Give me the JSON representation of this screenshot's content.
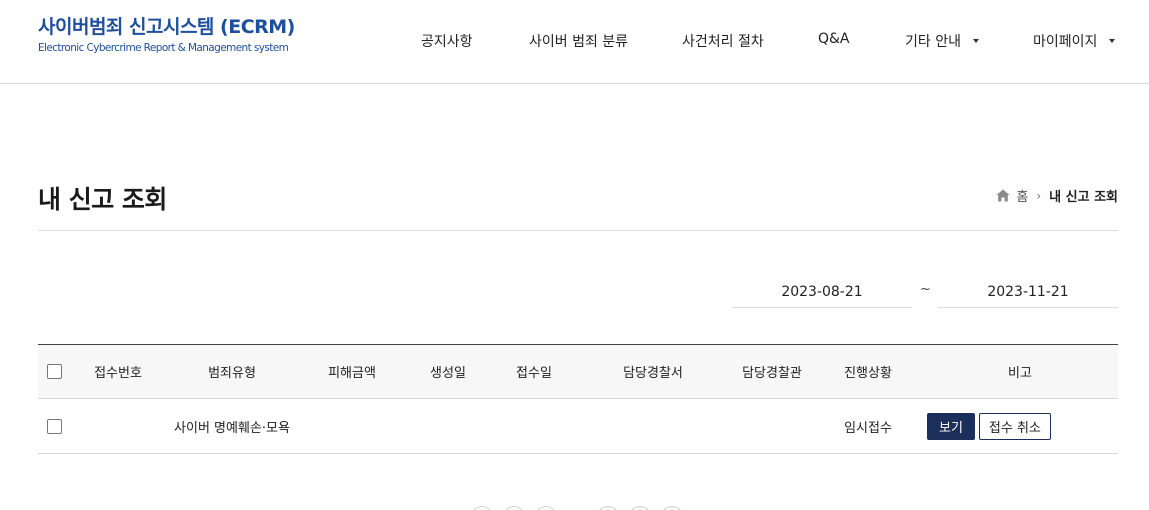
{
  "header": {
    "logo_title": "사이버범죄 신고시스템 (ECRM)",
    "logo_subtitle": "Electronic Cybercrime Report & Management system",
    "nav": [
      {
        "label": "공지사항",
        "has_dropdown": false
      },
      {
        "label": "사이버 범죄 분류",
        "has_dropdown": false
      },
      {
        "label": "사건처리 절차",
        "has_dropdown": false
      },
      {
        "label": "Q&A",
        "has_dropdown": false
      },
      {
        "label": "기타 안내",
        "has_dropdown": true
      },
      {
        "label": "마이페이지",
        "has_dropdown": true
      }
    ]
  },
  "page": {
    "title": "내 신고 조회",
    "breadcrumb": {
      "home": "홈",
      "current": "내 신고 조회"
    }
  },
  "filter": {
    "date_from": "2023-08-21",
    "separator": "~",
    "date_to": "2023-11-21"
  },
  "table": {
    "columns": [
      "접수번호",
      "범죄유형",
      "피해금액",
      "생성일",
      "접수일",
      "담당경찰서",
      "담당경찰관",
      "진행상황",
      "비고"
    ],
    "rows": [
      {
        "receipt_no": "",
        "crime_type": "사이버 명예훼손·모욕",
        "damage_amount": "",
        "created_date": "",
        "received_date": "",
        "police_station": "",
        "officer": "",
        "status": "임시접수",
        "view_label": "보기",
        "cancel_label": "접수 취소"
      }
    ]
  },
  "colors": {
    "brand_blue": "#1d4f9e",
    "button_navy": "#1b2f5a"
  }
}
